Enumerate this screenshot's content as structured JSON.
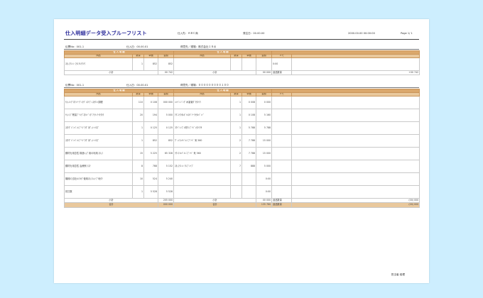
{
  "header": {
    "title": "仕入明細データ受入ブルーフリスト",
    "meta1": "仕入先：ＡＢＣ商",
    "meta2": "発注日：00.00.00",
    "meta3": "2000.00.00 00:00:00",
    "meta4": "Page 1/ 1"
  },
  "sections": [
    {
      "info": [
        "伝票No：001-1",
        "仕入日：00.00.01",
        "得意先／現場：株式会社１８の"
      ],
      "rows": [
        {
          "name": "ｽﾀｯﾌｸﾚﾝﾝ ﾌﾀﾚｱﾙｱｸｼｳ",
          "qty": "1",
          "price": "852",
          "amount": "852",
          "rname": "",
          "rqty": "",
          "rprice": "",
          "ramount": "",
          "note": "0:00"
        }
      ],
      "sub": {
        "label": "小計",
        "amount": "00 742",
        "rlabel": "小計",
        "ramount": "00 000",
        "tag": "返品数量",
        "end": "+00 742"
      }
    },
    {
      "info": [
        "伝票No：001-1",
        "仕入日：00.00.01",
        "得意先／現場：０００００００００１００"
      ],
      "rows": [
        {
          "name": "ﾓﾙｯｼｼｸﾞﾛｳｨﾘｰｸﾞﾚﾀﾃﾞｨﾛﾘﾌﾞﾚｽﾀｸｼﾝ調理",
          "qty": "110",
          "price": "0 108",
          "amount": "000 000",
          "rname": "ﾊﾝﾍﾞﾚｼﾞﾝｸﾞ木製置ﾀﾞｸﾀｸｼｳ",
          "rqty": "1",
          "rprice": "0 008",
          "ramount": "0 000",
          "note": ""
        },
        {
          "name": "ｻｯｼｼﾌﾞ貿易ﾌﾟﾘﾝｸﾞﾈﾀﾝﾄﾞｼﾀﾞｱﾗﾃｨｱｲｸｸﾀｸ",
          "qty": "20",
          "price": "194",
          "amount": "5 000",
          "rname": "ｸｸﾆｼｸﾗﾀﾙﾎﾟﾄﾙﾛﾍﾞﾘｰｸﾅﾀﾙﾍﾞｨﾄﾞ",
          "rqty": "1",
          "rprice": "0 108",
          "ramount": "5 160",
          "note": ""
        },
        {
          "name": "ｽﾀｸｸﾞﾊﾟﾝﾊﾟﾝﾙﾌﾞﾘｼﾞﾀｸﾞﾛﾀﾞｯﾄﾚｲﾛﾌﾞ",
          "qty": "1",
          "price": "0 125",
          "amount": "0 125",
          "rname": "ｺｳﾍﾞﾝﾝﾌﾞﾙ材ｸﾝﾌﾞﾘｼﾞﾚﾀｸｼｳｻ",
          "rqty": "1",
          "rprice": "5 788",
          "ramount": "5 788",
          "note": ""
        },
        {
          "name": "ｽﾀｸｸﾞﾊﾟﾝﾊﾟﾝﾙﾌﾞﾘｼﾞﾀｸﾞﾛﾀﾞｯﾄﾚｲﾛﾌﾞ",
          "qty": "1",
          "price": "852",
          "amount": "852",
          "rname": "ｳﾞｨﾝﾏﾝﾙﾍﾞﾙﾝﾆﾌﾟﾄﾍﾞ 気 560",
          "rqty": "2",
          "rprice": "7 788",
          "ramount": "15 000",
          "note": ""
        },
        {
          "name": "鋼材を用意性 構造ｼｮﾌﾟ用の利用 ｽﾀｯﾌ",
          "qty": "15",
          "price": "5 225",
          "amount": "65 328",
          "rname": "ﾗｳﾝﾏﾝﾙﾍﾞﾙﾝﾆﾌﾟﾄﾍﾞ 気 560",
          "rqty": "2",
          "rprice": "7 788",
          "ramount": "15 000",
          "note": ""
        },
        {
          "name": "鋼材を用意性 治療例 ﾗｽｸ",
          "qty": "8",
          "price": "788",
          "amount": "5 152",
          "rname": "ｽﾀｯﾌｸﾚﾝﾝ ｱﾙﾌﾞﾚｲﾌﾞ",
          "rqty": "7",
          "rprice": "888",
          "ramount": "5 000",
          "note": ""
        },
        {
          "name": "機械の当社ﾙﾙｸﾙﾀﾞ使用ｽﾀｯﾌﾙｯﾄﾌﾟ地ｸｸ",
          "qty": "10",
          "price": "524",
          "amount": "5 240",
          "rname": "",
          "rqty": "",
          "rprice": "",
          "ramount": "0:00",
          "note": ""
        },
        {
          "name": "初日数",
          "qty": "1",
          "price": "5 528",
          "amount": "5 528",
          "rname": "",
          "rqty": "",
          "rprice": "",
          "ramount": "0:00",
          "note": ""
        }
      ],
      "sub": {
        "label": "小計",
        "amount": "205 000",
        "rlabel": "小計",
        "ramount": "00 000",
        "tag": "返品数量",
        "end": "(00) 000"
      }
    }
  ],
  "total": {
    "label": "合計",
    "amount": "000 000",
    "rlabel": "合計",
    "ramount": "135 760",
    "tag": "返品数量",
    "end": "(00) 000"
  },
  "columns": {
    "group": "仕 入 明 細",
    "rgroup": "仕 入 明 細",
    "name": "商品",
    "qty": "数量",
    "price": "単価",
    "amount": "金額",
    "note": "メモ"
  },
  "footer": {
    "signature": "担当者 経理"
  }
}
